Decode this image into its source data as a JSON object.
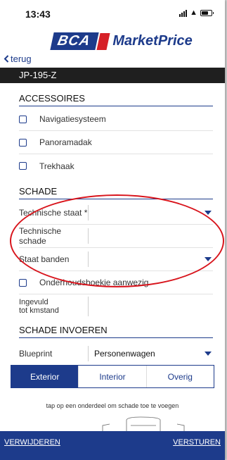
{
  "status_bar": {
    "time": "13:43"
  },
  "brand": {
    "left": "BCA",
    "right": "MarketPrice"
  },
  "nav": {
    "back_label": "terug"
  },
  "vehicle": {
    "plate": "JP-195-Z"
  },
  "accessories": {
    "heading": "ACCESSOIRES",
    "items": [
      {
        "label": "Navigatiesysteem"
      },
      {
        "label": "Panoramadak"
      },
      {
        "label": "Trekhaak"
      }
    ]
  },
  "damage": {
    "heading": "SCHADE",
    "fields": [
      {
        "label": "Technische staat *",
        "value": ""
      },
      {
        "label": "Technische schade",
        "value": ""
      },
      {
        "label": "Staat banden",
        "value": ""
      }
    ],
    "checkbox_label": "Onderhoudsboekje aanwezig",
    "km_label_line1": "Ingevuld",
    "km_label_line2": "tot kmstand",
    "km_value": ""
  },
  "damage_input": {
    "heading": "SCHADE INVOEREN",
    "blueprint_label": "Blueprint",
    "blueprint_value": "Personenwagen",
    "tabs": [
      {
        "label": "Exterior"
      },
      {
        "label": "Interior"
      },
      {
        "label": "Overig"
      }
    ],
    "active_tab": "Exterior",
    "hint": "tap op een onderdeel om schade toe te voegen"
  },
  "footer": {
    "left_label": "VERWIJDEREN",
    "right_label": "VERSTUREN"
  },
  "colors": {
    "brand_blue": "#1d3b8b",
    "brand_red": "#d62027",
    "annotation_red": "#d8141c"
  }
}
